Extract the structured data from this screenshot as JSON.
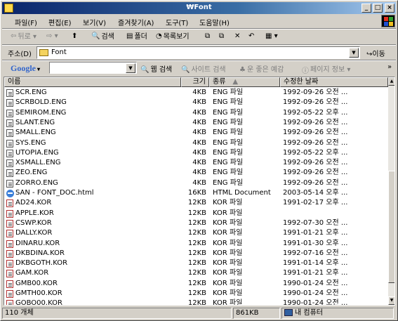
{
  "window": {
    "title": "₩Font"
  },
  "menu": [
    "파일(F)",
    "편집(E)",
    "보기(V)",
    "즐겨찾기(A)",
    "도구(T)",
    "도움말(H)"
  ],
  "toolbar": {
    "back_label": "뒤로",
    "search_label": "검색",
    "folders_label": "폴더",
    "history_label": "목록보기"
  },
  "address": {
    "label": "주소(D)",
    "value": "Font",
    "go_label": "이동"
  },
  "google": {
    "logo": "Google",
    "search_web": "웹 검색",
    "search_site": "사이트 검색",
    "feeling_lucky": "운 좋은 예감",
    "page_info": "페이지 정보"
  },
  "columns": {
    "name": "이름",
    "size": "크기",
    "type": "종류",
    "modified": "수정한 날짜"
  },
  "files": [
    {
      "name": "SCR.ENG",
      "size": "4KB",
      "type": "ENG 파일",
      "date": "1992-09-26 오전 ...",
      "icon": "file"
    },
    {
      "name": "SCRBOLD.ENG",
      "size": "4KB",
      "type": "ENG 파일",
      "date": "1992-09-26 오전 ...",
      "icon": "file"
    },
    {
      "name": "SEMIROM.ENG",
      "size": "4KB",
      "type": "ENG 파일",
      "date": "1992-05-22 오후 ...",
      "icon": "file"
    },
    {
      "name": "SLANT.ENG",
      "size": "4KB",
      "type": "ENG 파일",
      "date": "1992-09-26 오전 ...",
      "icon": "file"
    },
    {
      "name": "SMALL.ENG",
      "size": "4KB",
      "type": "ENG 파일",
      "date": "1992-09-26 오전 ...",
      "icon": "file"
    },
    {
      "name": "SYS.ENG",
      "size": "4KB",
      "type": "ENG 파일",
      "date": "1992-09-26 오전 ...",
      "icon": "file"
    },
    {
      "name": "UTOPIA.ENG",
      "size": "4KB",
      "type": "ENG 파일",
      "date": "1992-05-22 오후 ...",
      "icon": "file"
    },
    {
      "name": "XSMALL.ENG",
      "size": "4KB",
      "type": "ENG 파일",
      "date": "1992-09-26 오전 ...",
      "icon": "file"
    },
    {
      "name": "ZEO.ENG",
      "size": "4KB",
      "type": "ENG 파일",
      "date": "1992-09-26 오전 ...",
      "icon": "file"
    },
    {
      "name": "ZORRO.ENG",
      "size": "4KB",
      "type": "ENG 파일",
      "date": "1992-09-26 오전 ...",
      "icon": "file"
    },
    {
      "name": "SAN - FONT_DOC.html",
      "size": "16KB",
      "type": "HTML Document",
      "date": "2003-05-14 오후 ...",
      "icon": "html"
    },
    {
      "name": "AD24.KOR",
      "size": "12KB",
      "type": "KOR 파일",
      "date": "1991-02-17 오후 ...",
      "icon": "kor"
    },
    {
      "name": "APPLE.KOR",
      "size": "12KB",
      "type": "KOR 파일",
      "date": "",
      "icon": "kor"
    },
    {
      "name": "CSWP.KOR",
      "size": "12KB",
      "type": "KOR 파일",
      "date": "1992-07-30 오전 ...",
      "icon": "kor"
    },
    {
      "name": "DALLY.KOR",
      "size": "12KB",
      "type": "KOR 파일",
      "date": "1991-01-21 오후 ...",
      "icon": "kor"
    },
    {
      "name": "DINARU.KOR",
      "size": "12KB",
      "type": "KOR 파일",
      "date": "1991-01-30 오후 ...",
      "icon": "kor"
    },
    {
      "name": "DKBDINA.KOR",
      "size": "12KB",
      "type": "KOR 파일",
      "date": "1992-07-16 오전 ...",
      "icon": "kor"
    },
    {
      "name": "DKBGOTH.KOR",
      "size": "12KB",
      "type": "KOR 파일",
      "date": "1991-01-14 오후 ...",
      "icon": "kor"
    },
    {
      "name": "GAM.KOR",
      "size": "12KB",
      "type": "KOR 파일",
      "date": "1991-01-21 오후 ...",
      "icon": "kor"
    },
    {
      "name": "GMB00.KOR",
      "size": "12KB",
      "type": "KOR 파일",
      "date": "1990-01-24 오전 ...",
      "icon": "kor"
    },
    {
      "name": "GMTH00.KOR",
      "size": "12KB",
      "type": "KOR 파일",
      "date": "1990-01-24 오전 ...",
      "icon": "kor"
    },
    {
      "name": "GOBO00.KOR",
      "size": "12KB",
      "type": "KOR 파일",
      "date": "1990-01-24 오전 ...",
      "icon": "kor"
    }
  ],
  "status": {
    "count": "110 개체",
    "size": "861KB",
    "location": "내 컴퓨터"
  }
}
